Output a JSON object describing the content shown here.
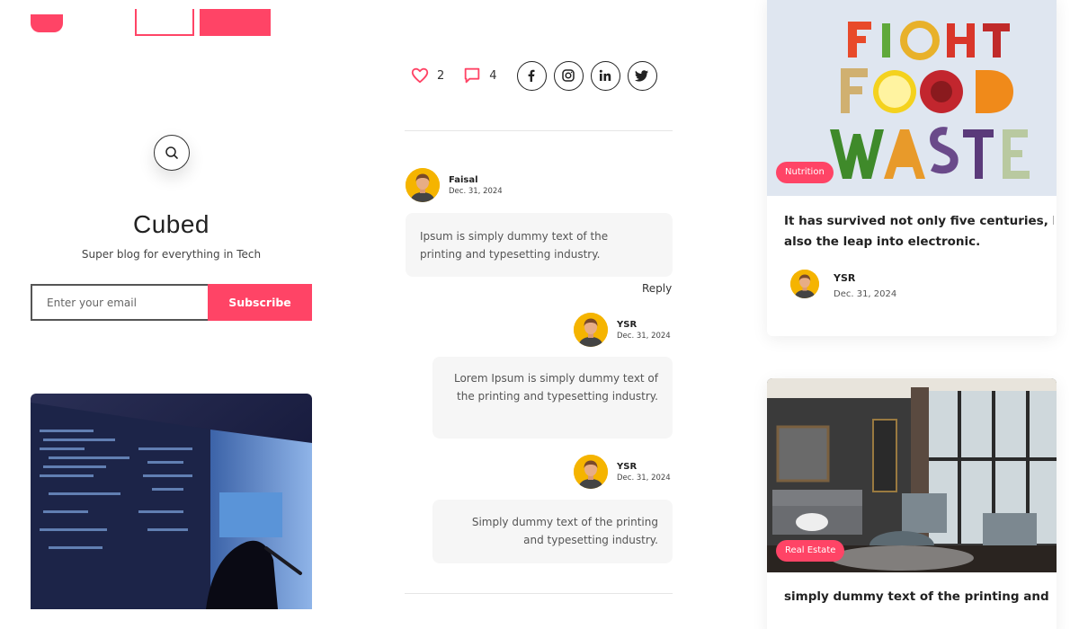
{
  "header": {
    "brand_color": "#ff4466"
  },
  "sidebar": {
    "search_icon": "search-icon",
    "blog_name": "Cubed",
    "tagline": "Super blog for everything in Tech",
    "email_placeholder": "Enter your email",
    "subscribe_label": "Subscribe"
  },
  "post": {
    "likes": "2",
    "comments": "4",
    "social_icons": [
      "facebook-icon",
      "instagram-icon",
      "linkedin-icon",
      "twitter-icon"
    ],
    "comment_list": [
      {
        "name": "Faisal",
        "date": "Dec. 31, 2024",
        "text": "Ipsum is simply dummy text of the printing and typesetting industry.",
        "reply_label": "Reply"
      },
      {
        "name": "YSR",
        "date": "Dec. 31, 2024",
        "text": "Lorem Ipsum is simply dummy text of the printing and typesetting industry."
      },
      {
        "name": "YSR",
        "date": "Dec. 31, 2024",
        "text": "Simply dummy text of the printing and typesetting industry."
      }
    ]
  },
  "related": [
    {
      "tag": "Nutrition",
      "title_line1": "It has survived not only five centuries, but",
      "title_line2": "also the leap into electronic.",
      "author": "YSR",
      "date": "Dec. 31, 2024"
    },
    {
      "tag": "Real Estate",
      "title_line1": "simply dummy text of the printing and"
    }
  ]
}
